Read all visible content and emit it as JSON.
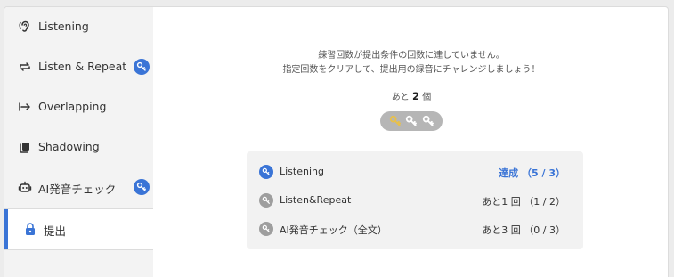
{
  "sidebar": {
    "items": [
      {
        "label": "Listening",
        "icon": "ear-icon",
        "has_badge": false
      },
      {
        "label": "Listen & Repeat",
        "icon": "repeat-icon",
        "has_badge": true
      },
      {
        "label": "Overlapping",
        "icon": "arrow-right-bar-icon",
        "has_badge": false
      },
      {
        "label": "Shadowing",
        "icon": "layers-icon",
        "has_badge": false
      },
      {
        "label": "AI発音チェック",
        "icon": "robot-icon",
        "has_badge": true
      },
      {
        "label": "提出",
        "icon": "lock-icon",
        "active": true
      }
    ]
  },
  "main": {
    "message_line1": "練習回数が提出条件の回数に達していません。",
    "message_line2": "指定回数をクリアして、提出用の録音にチャレンジしましょう！",
    "remaining_prefix": "あと",
    "remaining_count": "2",
    "remaining_suffix": "個",
    "keys": {
      "total": 3,
      "earned": 1
    },
    "requirements": [
      {
        "name": "Listening",
        "status": "達成 （5 / 3）",
        "achieved": true
      },
      {
        "name": "Listen&Repeat",
        "status": "あと1 回 （1 / 2）",
        "achieved": false
      },
      {
        "name": "AI発音チェック（全文）",
        "status": "あと3 回 （0 / 3）",
        "achieved": false
      }
    ]
  },
  "colors": {
    "accent": "#3a74d6",
    "key_gold": "#e8c04a",
    "key_gray": "#9e9e9e"
  }
}
